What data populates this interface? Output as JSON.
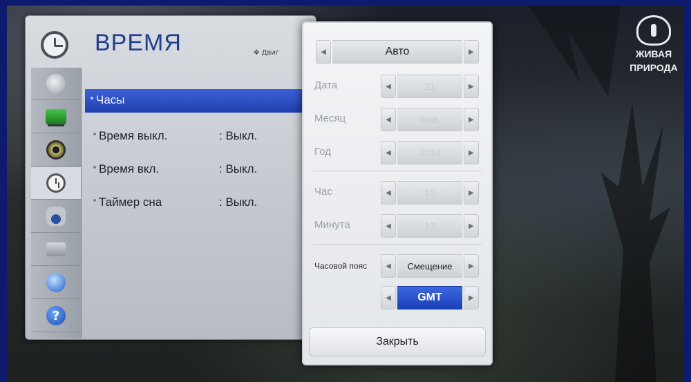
{
  "screen": {
    "title": "ВРЕМЯ",
    "move_hint": "Двиг",
    "accent_color": "#1f3fae"
  },
  "sidebar": {
    "items": [
      {
        "icon": "satellite-dish-icon"
      },
      {
        "icon": "tv-screen-icon"
      },
      {
        "icon": "speaker-icon"
      },
      {
        "icon": "clock-icon",
        "active": true
      },
      {
        "icon": "lock-icon"
      },
      {
        "icon": "briefcase-icon"
      },
      {
        "icon": "globe-icon"
      },
      {
        "icon": "help-icon",
        "glyph": "?"
      }
    ]
  },
  "menu": {
    "items": [
      {
        "label": "Часы",
        "value": ""
      },
      {
        "label": "Время выкл.",
        "value": ": Выкл."
      },
      {
        "label": "Время вкл.",
        "value": ": Выкл."
      },
      {
        "label": "Таймер сна",
        "value": ": Выкл."
      }
    ]
  },
  "dialog": {
    "mode": "Авто",
    "date_label": "Дата",
    "date_value": "21",
    "month_label": "Месяц",
    "month_value": "Фев.",
    "year_label": "Год",
    "year_value": "2014",
    "hour_label": "Час",
    "hour_value": "10",
    "minute_label": "Минута",
    "minute_value": "13",
    "timezone_label": "Часовой пояс",
    "timezone_mode": "Смещение",
    "timezone_value": "GMT",
    "close_label": "Закрыть"
  },
  "logo": {
    "line1": "ЖИВАЯ",
    "line2": "ПРИРОДА"
  }
}
